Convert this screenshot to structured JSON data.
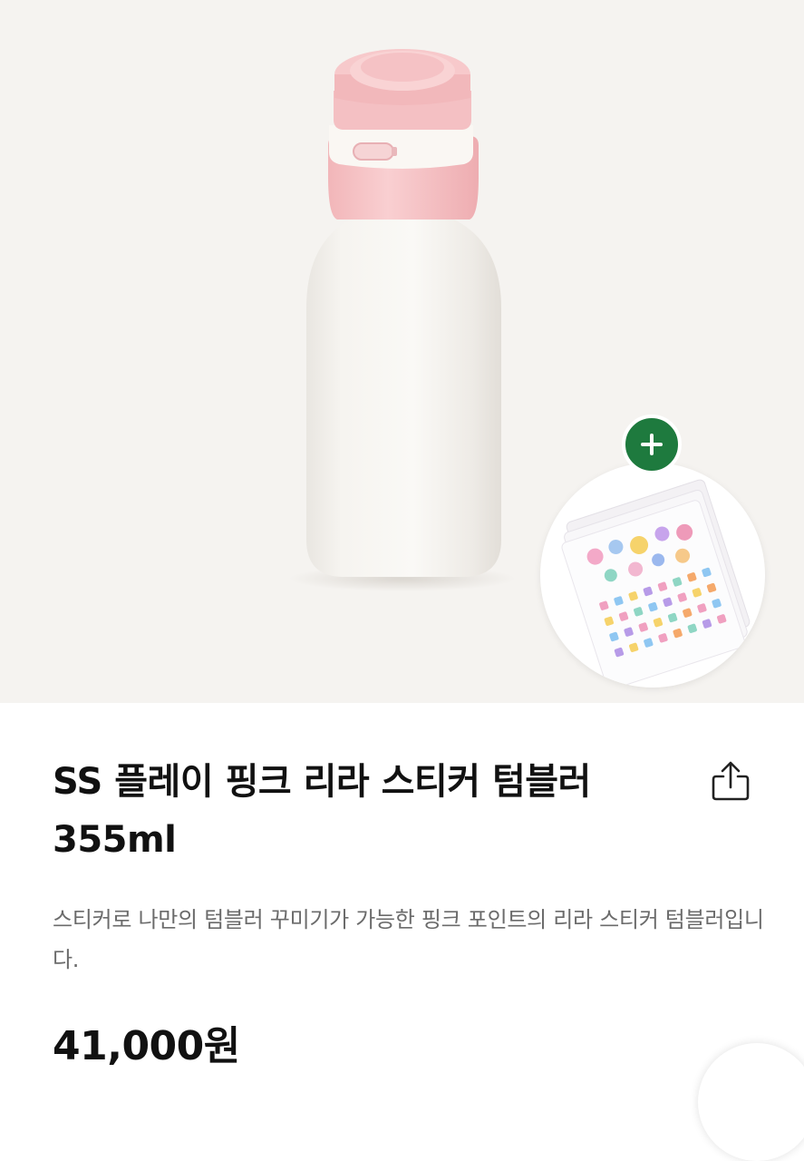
{
  "product": {
    "title": "SS 플레이 핑크 리라 스티커 텀블러 355ml",
    "description": "스티커로 나만의 텀블러 꾸미기가 가능한 핑크 포인트의 리라 스티커 텀블러입니다.",
    "price": "41,000원"
  },
  "icons": {
    "share": "share-icon",
    "plus": "plus-icon"
  },
  "colors": {
    "accent_green": "#1e7a3e",
    "bottle_pink": "#f7c6c8",
    "hero_background": "#f5f3f0"
  }
}
